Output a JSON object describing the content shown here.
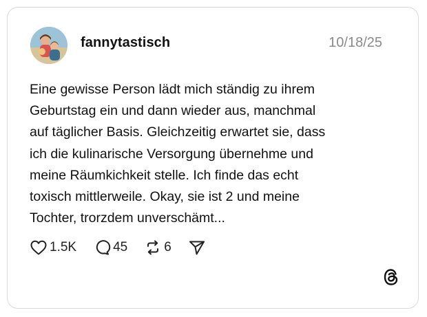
{
  "post": {
    "author": "fannytastisch",
    "date": "10/18/25",
    "text": "Eine gewisse Person lädt mich ständig zu ihrem\nGeburtstag ein und dann wieder aus, manchmal\nauf täglicher Basis. Gleichzeitig erwartet sie, dass\nich die kulinarische Versorgung übernehme und\nmeine Räumkichkeit stelle. Ich finde das echt\ntoxisch mittlerweile. Okay, sie ist 2 und meine\nTochter, trorzdem unverschämt..."
  },
  "actions": {
    "likes": "1.5K",
    "replies": "45",
    "reposts": "6"
  },
  "icons": [
    "heart-icon",
    "reply-icon",
    "repost-icon",
    "share-icon",
    "threads-logo-icon"
  ]
}
